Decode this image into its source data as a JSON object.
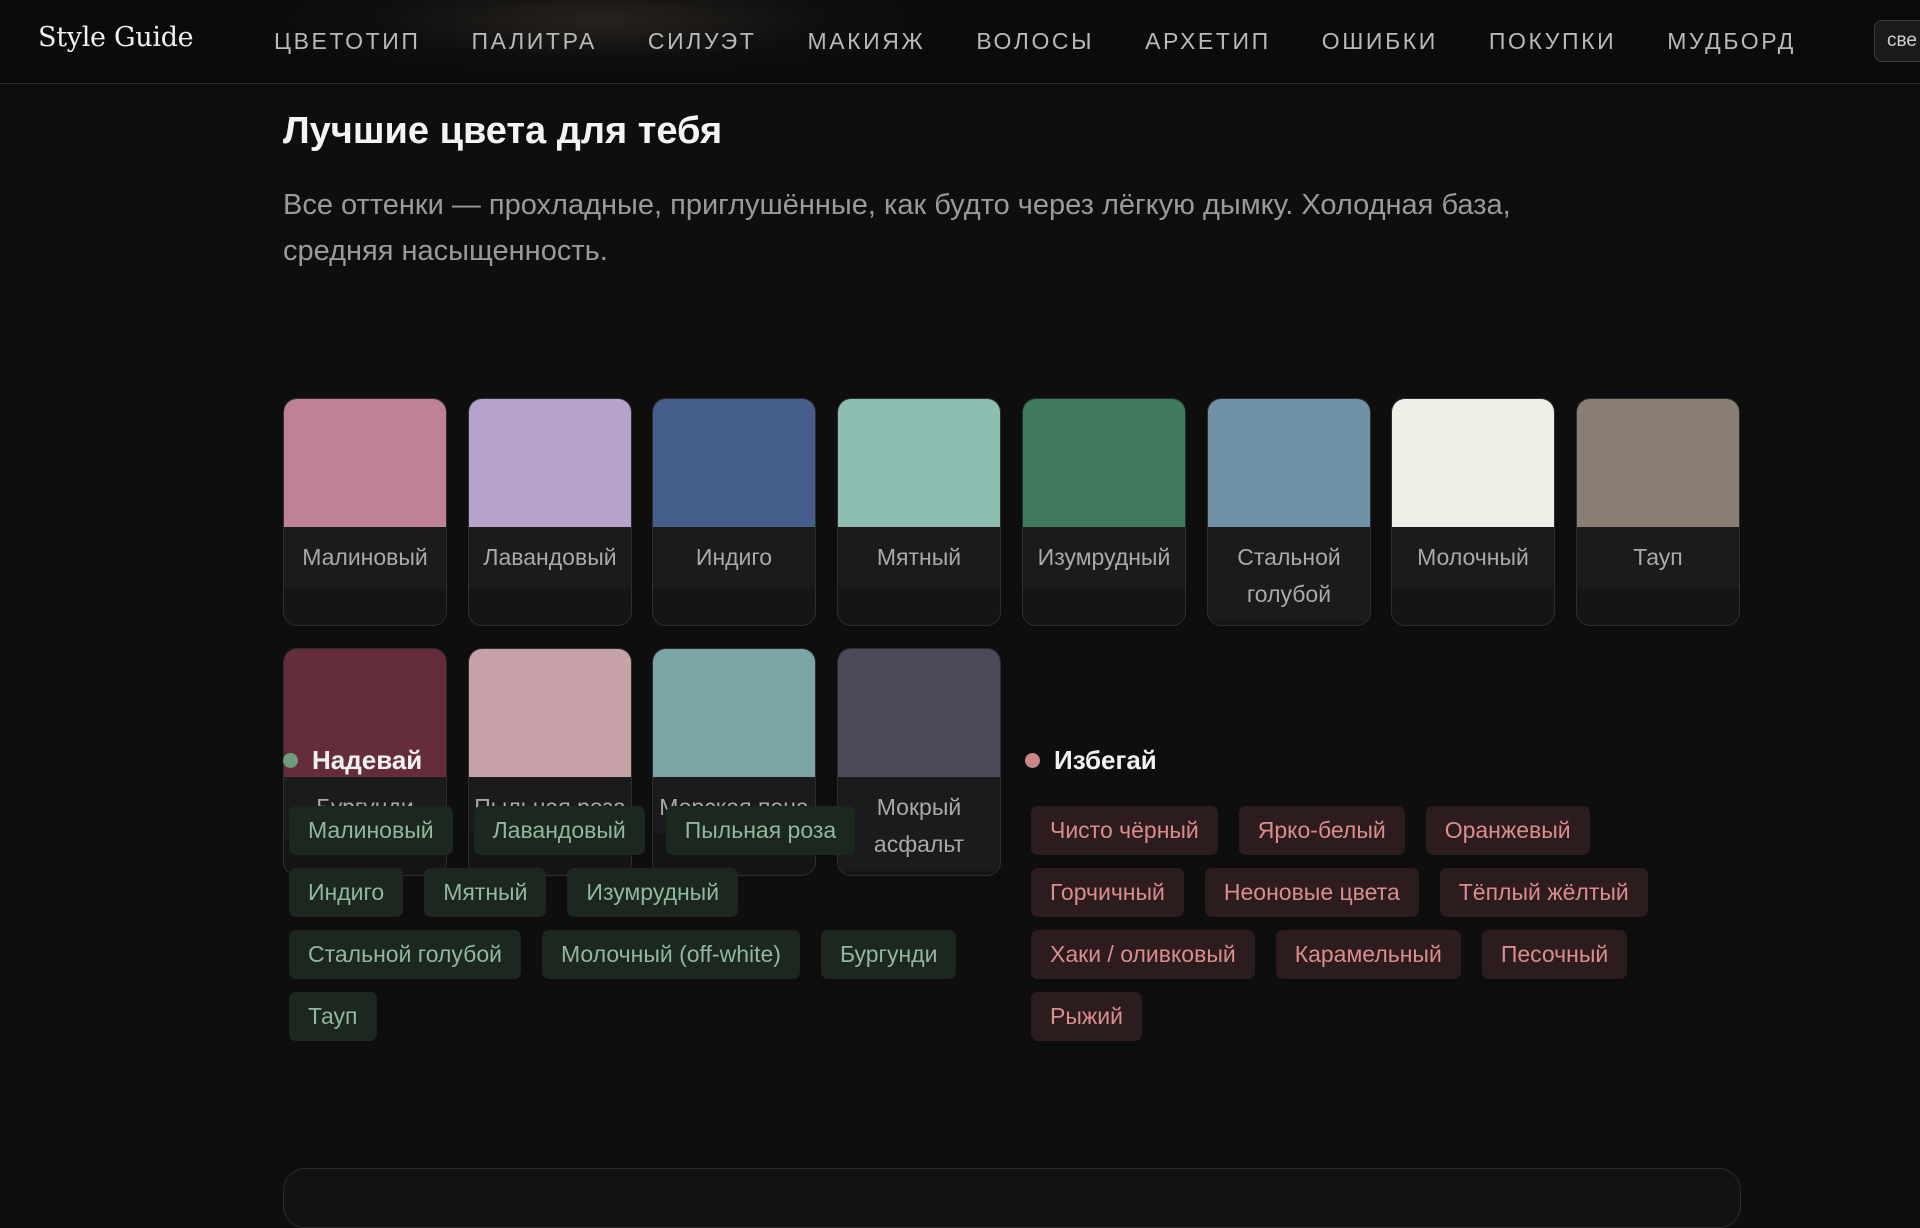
{
  "brand": "Style Guide",
  "nav": [
    "ЦВЕТОТИП",
    "ПАЛИТРА",
    "СИЛУЭТ",
    "МАКИЯЖ",
    "ВОЛОСЫ",
    "АРХЕТИП",
    "ОШИБКИ",
    "ПОКУПКИ",
    "МУДБОРД"
  ],
  "theme_toggle": "све",
  "section": {
    "title": "Лучшие цвета для тебя",
    "description": "Все оттенки — прохладные, приглушённые, как будто через лёгкую дымку. Холодная база, средняя насыщенность."
  },
  "swatches": [
    {
      "name": "Малиновый",
      "color": "#be8198"
    },
    {
      "name": "Лавандовый",
      "color": "#b6a2cb"
    },
    {
      "name": "Индиго",
      "color": "#455e8b"
    },
    {
      "name": "Мятный",
      "color": "#8ebdb1"
    },
    {
      "name": "Изумрудный",
      "color": "#3f7a5c"
    },
    {
      "name": "Стальной голубой",
      "color": "#7191a6"
    },
    {
      "name": "Молочный",
      "color": "#efefe7"
    },
    {
      "name": "Тауп",
      "color": "#8a7d72"
    },
    {
      "name": "Бургунди",
      "color": "#652d3c"
    },
    {
      "name": "Пыльная роза",
      "color": "#c7a2a8"
    },
    {
      "name": "Морская пена",
      "color": "#7aa4a5"
    },
    {
      "name": "Мокрый асфальт",
      "color": "#4a4a5a"
    }
  ],
  "wear": {
    "title": "Надевай",
    "dot_color": "#6e9c7a",
    "items": [
      "Малиновый",
      "Лавандовый",
      "Пыльная роза",
      "Индиго",
      "Мятный",
      "Изумрудный",
      "Стальной голубой",
      "Молочный (off-white)",
      "Бургунди",
      "Тауп"
    ]
  },
  "avoid": {
    "title": "Избегай",
    "dot_color": "#c98787",
    "items": [
      "Чисто чёрный",
      "Ярко-белый",
      "Оранжевый",
      "Горчичный",
      "Неоновые цвета",
      "Тёплый жёлтый",
      "Хаки / оливковый",
      "Карамельный",
      "Песочный",
      "Рыжий"
    ]
  }
}
